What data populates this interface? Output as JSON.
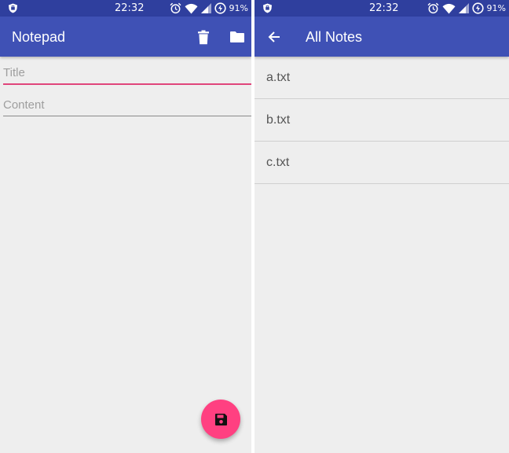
{
  "status_bar": {
    "time": "22:32",
    "battery": "91%",
    "icons": [
      "shield-icon",
      "alarm-icon",
      "wifi-icon",
      "signal-icon",
      "battery-saver-icon"
    ]
  },
  "colors": {
    "status_bar": "#2f3f9e",
    "app_bar": "#3f51b5",
    "accent": "#ff4081",
    "focused_underline": "#e0457b",
    "background": "#eeeeee"
  },
  "editor": {
    "app_title": "Notepad",
    "actions": [
      "delete-icon",
      "folder-icon"
    ],
    "title_field": {
      "placeholder": "Title",
      "value": ""
    },
    "content_field": {
      "placeholder": "Content",
      "value": ""
    },
    "fab_icon": "save-icon"
  },
  "notes_screen": {
    "title": "All Notes",
    "back_icon": "arrow-back-icon",
    "notes": [
      "a.txt",
      "b.txt",
      "c.txt"
    ]
  }
}
